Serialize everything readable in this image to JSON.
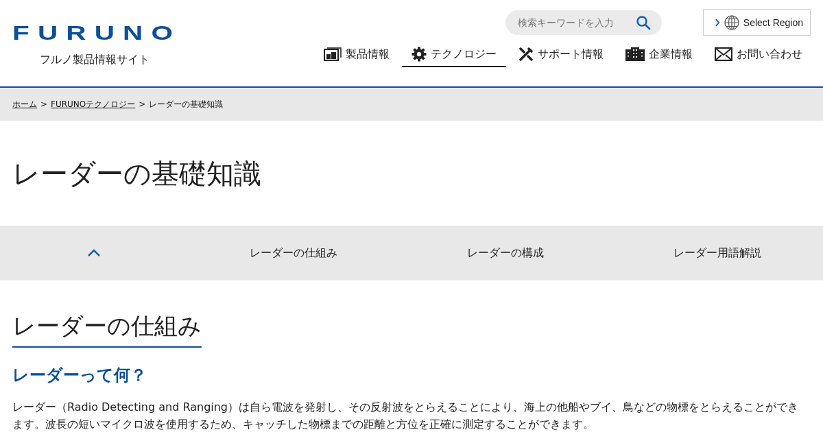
{
  "header": {
    "logo": "FURUNO",
    "site_name": "フルノ製品情報サイト",
    "search": {
      "placeholder": "検索キーワードを入力"
    },
    "region_button": "Select Region",
    "nav": [
      {
        "label": "製品情報",
        "kind": "products",
        "selected": false
      },
      {
        "label": "テクノロジー",
        "kind": "technology",
        "selected": true
      },
      {
        "label": "サポート情報",
        "kind": "support",
        "selected": false
      },
      {
        "label": "企業情報",
        "kind": "company",
        "selected": false
      },
      {
        "label": "お問い合わせ",
        "kind": "contact",
        "selected": false
      }
    ]
  },
  "breadcrumb": [
    {
      "label": "ホーム",
      "link": true
    },
    {
      "label": "FURUNOテクノロジー",
      "link": true
    },
    {
      "label": "レーダーの基礎知識",
      "link": false
    }
  ],
  "breadcrumb_separator": ">",
  "page_title": "レーダーの基礎知識",
  "anchor_nav": [
    "レーダーの仕組み",
    "レーダーの構成",
    "レーダー用語解説"
  ],
  "section": {
    "heading": "レーダーの仕組み",
    "subheading": "レーダーって何？",
    "body": "レーダー（Radio Detecting and Ranging）は自ら電波を発射し、その反射波をとらえることにより、海上の他船やブイ、鳥などの物標をとらえることができます。波長の短いマイクロ波を使用するため、キャッチした物標までの距離と方位を正確に測定することができます。"
  }
}
